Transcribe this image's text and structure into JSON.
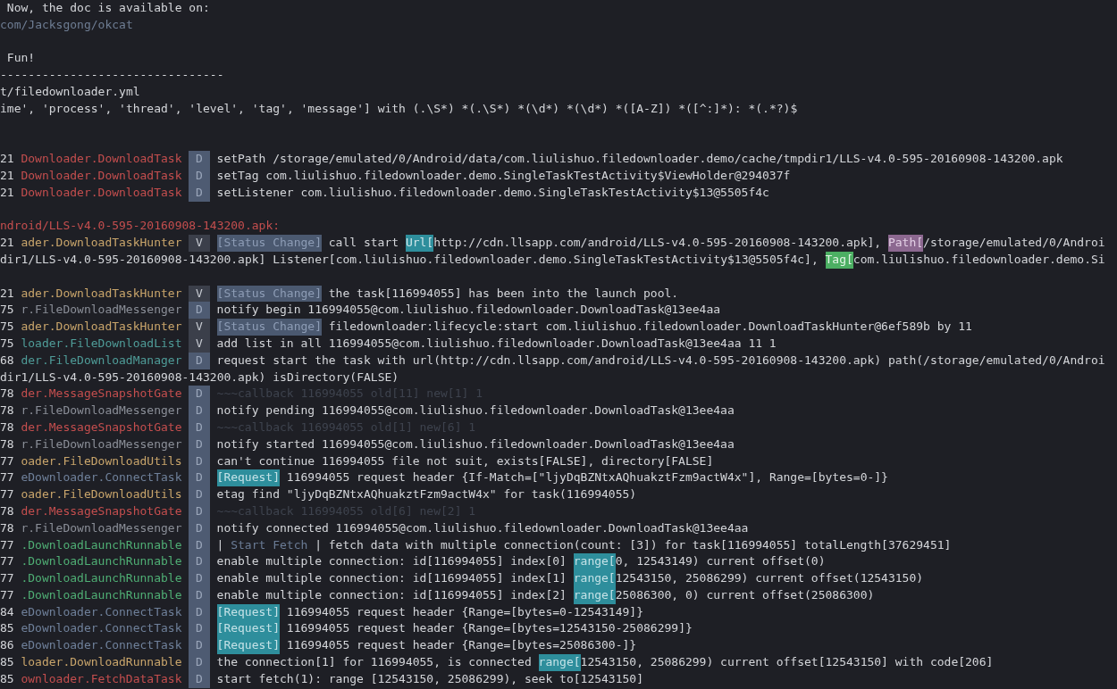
{
  "lines": [
    {
      "kind": "text",
      "text": " Now, the doc is available on:",
      "color": "#d4d6da"
    },
    {
      "kind": "text",
      "text": "com/Jacksgong/okcat",
      "color": "#6e7d93"
    },
    {
      "kind": "blank"
    },
    {
      "kind": "text",
      "text": " Fun!",
      "color": "#d4d6da"
    },
    {
      "kind": "text",
      "text": "--------------------------------",
      "color": "#d4d6da"
    },
    {
      "kind": "text",
      "text": "t/filedownloader.yml",
      "color": "#d4d6da"
    },
    {
      "kind": "text",
      "text": "ime', 'process', 'thread', 'level', 'tag', 'message'] with (.\\S*) *(.\\S*) *(\\d*) *(\\d*) *([A-Z]) *([^:]*): *(.*?)$",
      "color": "#d4d6da"
    },
    {
      "kind": "blank"
    },
    {
      "kind": "blank"
    },
    {
      "kind": "log",
      "pid": "21",
      "tag": "Downloader.DownloadTask",
      "color": "#c44e4e",
      "level": "D",
      "segments": [
        {
          "kind": "plain",
          "text": "setPath /storage/emulated/0/Android/data/com.liulishuo.filedownloader.demo/cache/tmpdir1/LLS-v4.0-595-20160908-143200.apk"
        }
      ]
    },
    {
      "kind": "log",
      "pid": "21",
      "tag": "Downloader.DownloadTask",
      "color": "#c44e4e",
      "level": "D",
      "segments": [
        {
          "kind": "plain",
          "text": "setTag com.liulishuo.filedownloader.demo.SingleTaskTestActivity$ViewHolder@294037f"
        }
      ]
    },
    {
      "kind": "log",
      "pid": "21",
      "tag": "Downloader.DownloadTask",
      "color": "#c44e4e",
      "level": "D",
      "segments": [
        {
          "kind": "plain",
          "text": "setListener com.liulishuo.filedownloader.demo.SingleTaskTestActivity$13@5505f4c"
        }
      ]
    },
    {
      "kind": "blank"
    },
    {
      "kind": "text",
      "text": "ndroid/LLS-v4.0-595-20160908-143200.apk:",
      "color": "#c44e4e"
    },
    {
      "kind": "log",
      "pid": "21",
      "tag": "ader.DownloadTaskHunter",
      "color": "#c9a56b",
      "level": "V",
      "segments": [
        {
          "kind": "status",
          "text": "[Status Change]"
        },
        {
          "kind": "plain",
          "text": " call start "
        },
        {
          "kind": "url",
          "text": "Url["
        },
        {
          "kind": "plain",
          "text": "http://cdn.llsapp.com/android/LLS-v4.0-595-20160908-143200.apk], "
        },
        {
          "kind": "path",
          "text": "Path["
        },
        {
          "kind": "plain",
          "text": "/storage/emulated/0/Androi"
        }
      ]
    },
    {
      "kind": "continuation",
      "segments": [
        {
          "kind": "plain",
          "text": "dir1/LLS-v4.0-595-20160908-143200.apk] Listener[com.liulishuo.filedownloader.demo.SingleTaskTestActivity$13@5505f4c], "
        },
        {
          "kind": "tag",
          "text": "Tag["
        },
        {
          "kind": "plain",
          "text": "com.liulishuo.filedownloader.demo.Si"
        }
      ]
    },
    {
      "kind": "blank"
    },
    {
      "kind": "log",
      "pid": "21",
      "tag": "ader.DownloadTaskHunter",
      "color": "#c9a56b",
      "level": "V",
      "segments": [
        {
          "kind": "status",
          "text": "[Status Change]"
        },
        {
          "kind": "plain",
          "text": " the task[116994055] has been into the launch pool."
        }
      ]
    },
    {
      "kind": "log",
      "pid": "75",
      "tag": "r.FileDownloadMessenger",
      "color": "#8b8f98",
      "level": "D",
      "segments": [
        {
          "kind": "plain",
          "text": "notify begin 116994055@com.liulishuo.filedownloader.DownloadTask@13ee4aa"
        }
      ]
    },
    {
      "kind": "log",
      "pid": "75",
      "tag": "ader.DownloadTaskHunter",
      "color": "#c9a56b",
      "level": "V",
      "segments": [
        {
          "kind": "status",
          "text": "[Status Change]"
        },
        {
          "kind": "plain",
          "text": " filedownloader:lifecycle:start com.liulishuo.filedownloader.DownloadTaskHunter@6ef589b by 11"
        }
      ]
    },
    {
      "kind": "log",
      "pid": "75",
      "tag": "loader.FileDownloadList",
      "color": "#4f9c98",
      "level": "V",
      "segments": [
        {
          "kind": "plain",
          "text": "add list in all 116994055@com.liulishuo.filedownloader.DownloadTask@13ee4aa 11 1"
        }
      ]
    },
    {
      "kind": "log",
      "pid": "68",
      "tag": "der.FileDownloadManager",
      "color": "#4f9c98",
      "level": "D",
      "segments": [
        {
          "kind": "plain",
          "text": "request start the task with url(http://cdn.llsapp.com/android/LLS-v4.0-595-20160908-143200.apk) path(/storage/emulated/0/Androi"
        }
      ]
    },
    {
      "kind": "continuation",
      "segments": [
        {
          "kind": "plain",
          "text": "dir1/LLS-v4.0-595-20160908-143200.apk) isDirectory(FALSE)"
        }
      ]
    },
    {
      "kind": "log",
      "pid": "78",
      "tag": "der.MessageSnapshotGate",
      "color": "#c44e4e",
      "level": "D",
      "segments": [
        {
          "kind": "dim",
          "text": "~~~callback 116994055 old[11] new[1] 1"
        }
      ]
    },
    {
      "kind": "log",
      "pid": "78",
      "tag": "r.FileDownloadMessenger",
      "color": "#8b8f98",
      "level": "D",
      "segments": [
        {
          "kind": "plain",
          "text": "notify pending 116994055@com.liulishuo.filedownloader.DownloadTask@13ee4aa"
        }
      ]
    },
    {
      "kind": "log",
      "pid": "78",
      "tag": "der.MessageSnapshotGate",
      "color": "#c44e4e",
      "level": "D",
      "segments": [
        {
          "kind": "dim",
          "text": "~~~callback 116994055 old[1] new[6] 1"
        }
      ]
    },
    {
      "kind": "log",
      "pid": "78",
      "tag": "r.FileDownloadMessenger",
      "color": "#8b8f98",
      "level": "D",
      "segments": [
        {
          "kind": "plain",
          "text": "notify started 116994055@com.liulishuo.filedownloader.DownloadTask@13ee4aa"
        }
      ]
    },
    {
      "kind": "log",
      "pid": "77",
      "tag": "oader.FileDownloadUtils",
      "color": "#c9a56b",
      "level": "D",
      "segments": [
        {
          "kind": "plain",
          "text": "can't continue 116994055 file not suit, exists[FALSE], directory[FALSE]"
        }
      ]
    },
    {
      "kind": "log",
      "pid": "77",
      "tag": "eDownloader.ConnectTask",
      "color": "#6f809a",
      "level": "D",
      "segments": [
        {
          "kind": "request",
          "text": "[Request]"
        },
        {
          "kind": "plain",
          "text": " 116994055 request header {If-Match=[\"ljyDqBZNtxAQhuakztFzm9actW4x\"], Range=[bytes=0-]}"
        }
      ]
    },
    {
      "kind": "log",
      "pid": "77",
      "tag": "oader.FileDownloadUtils",
      "color": "#c9a56b",
      "level": "D",
      "segments": [
        {
          "kind": "plain",
          "text": "etag find \"ljyDqBZNtxAQhuakztFzm9actW4x\" for task(116994055)"
        }
      ]
    },
    {
      "kind": "log",
      "pid": "78",
      "tag": "der.MessageSnapshotGate",
      "color": "#c44e4e",
      "level": "D",
      "segments": [
        {
          "kind": "dim",
          "text": "~~~callback 116994055 old[6] new[2] 1"
        }
      ]
    },
    {
      "kind": "log",
      "pid": "78",
      "tag": "r.FileDownloadMessenger",
      "color": "#8b8f98",
      "level": "D",
      "segments": [
        {
          "kind": "plain",
          "text": "notify connected 116994055@com.liulishuo.filedownloader.DownloadTask@13ee4aa"
        }
      ]
    },
    {
      "kind": "log",
      "pid": "77",
      "tag": ".DownloadLaunchRunnable",
      "color": "#4fae74",
      "level": "D",
      "segments": [
        {
          "kind": "plain",
          "text": "| "
        },
        {
          "kind": "muted",
          "text": "Start Fetch"
        },
        {
          "kind": "plain",
          "text": " | fetch data with multiple connection(count: [3]) for task[116994055] totalLength[37629451]"
        }
      ]
    },
    {
      "kind": "log",
      "pid": "77",
      "tag": ".DownloadLaunchRunnable",
      "color": "#4fae74",
      "level": "D",
      "segments": [
        {
          "kind": "plain",
          "text": "enable multiple connection: id[116994055] index[0] "
        },
        {
          "kind": "range",
          "text": "range["
        },
        {
          "kind": "plain",
          "text": "0, 12543149) current offset(0)"
        }
      ]
    },
    {
      "kind": "log",
      "pid": "77",
      "tag": ".DownloadLaunchRunnable",
      "color": "#4fae74",
      "level": "D",
      "segments": [
        {
          "kind": "plain",
          "text": "enable multiple connection: id[116994055] index[1] "
        },
        {
          "kind": "range",
          "text": "range["
        },
        {
          "kind": "plain",
          "text": "12543150, 25086299) current offset(12543150)"
        }
      ]
    },
    {
      "kind": "log",
      "pid": "77",
      "tag": ".DownloadLaunchRunnable",
      "color": "#4fae74",
      "level": "D",
      "segments": [
        {
          "kind": "plain",
          "text": "enable multiple connection: id[116994055] index[2] "
        },
        {
          "kind": "range",
          "text": "range["
        },
        {
          "kind": "plain",
          "text": "25086300, 0) current offset(25086300)"
        }
      ]
    },
    {
      "kind": "log",
      "pid": "84",
      "tag": "eDownloader.ConnectTask",
      "color": "#6f809a",
      "level": "D",
      "segments": [
        {
          "kind": "request",
          "text": "[Request]"
        },
        {
          "kind": "plain",
          "text": " 116994055 request header {Range=[bytes=0-12543149]}"
        }
      ]
    },
    {
      "kind": "log",
      "pid": "85",
      "tag": "eDownloader.ConnectTask",
      "color": "#6f809a",
      "level": "D",
      "segments": [
        {
          "kind": "request",
          "text": "[Request]"
        },
        {
          "kind": "plain",
          "text": " 116994055 request header {Range=[bytes=12543150-25086299]}"
        }
      ]
    },
    {
      "kind": "log",
      "pid": "86",
      "tag": "eDownloader.ConnectTask",
      "color": "#6f809a",
      "level": "D",
      "segments": [
        {
          "kind": "request",
          "text": "[Request]"
        },
        {
          "kind": "plain",
          "text": " 116994055 request header {Range=[bytes=25086300-]}"
        }
      ]
    },
    {
      "kind": "log",
      "pid": "85",
      "tag": "loader.DownloadRunnable",
      "color": "#c9a56b",
      "level": "D",
      "segments": [
        {
          "kind": "plain",
          "text": "the connection[1] for 116994055, is connected "
        },
        {
          "kind": "range",
          "text": "range["
        },
        {
          "kind": "plain",
          "text": "12543150, 25086299) current offset[12543150] with code[206]"
        }
      ]
    },
    {
      "kind": "log",
      "pid": "85",
      "tag": "ownloader.FetchDataTask",
      "color": "#c44e4e",
      "level": "D",
      "segments": [
        {
          "kind": "plain",
          "text": "start fetch(1): range [12543150, 25086299), seek to[12543150]"
        }
      ]
    }
  ]
}
